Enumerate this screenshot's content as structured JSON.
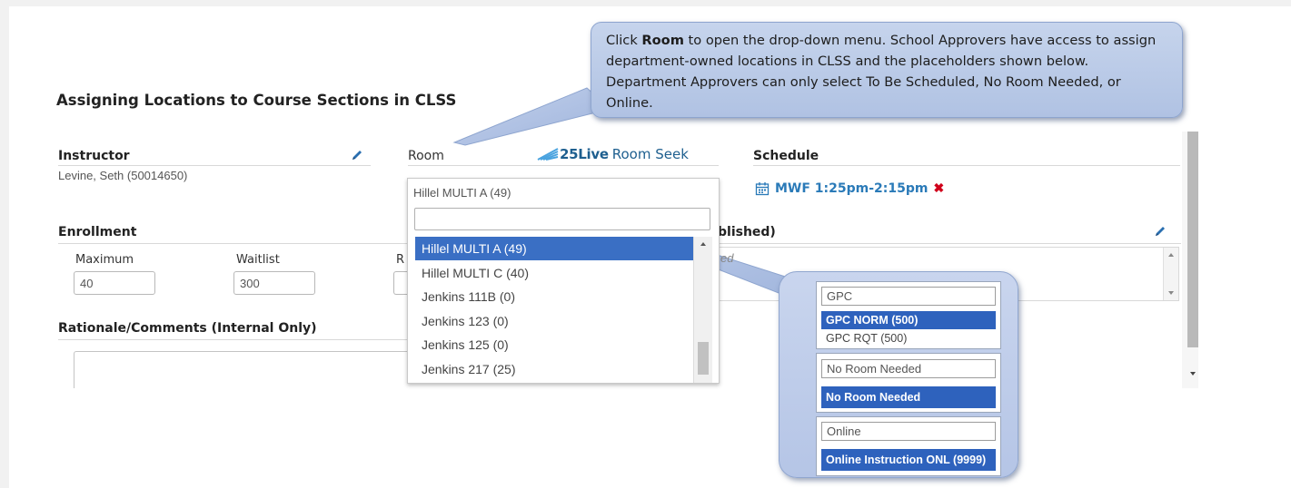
{
  "page": {
    "title": "Assigning Locations to Course Sections in CLSS"
  },
  "callout": {
    "part1": "Click ",
    "bold": "Room",
    "part2": " to open the drop-down menu. School Approvers have access to assign department-owned locations in CLSS and the placeholders shown below. Department Approvers can only select To Be Scheduled, No Room Needed, or Online."
  },
  "instructor": {
    "label": "Instructor",
    "value": "Levine, Seth (50014650)"
  },
  "room": {
    "label": "Room",
    "brand_name": "25Live",
    "brand_suffix": "Room Seek",
    "current": "Hillel MULTI A (49)",
    "search_value": "",
    "options": [
      "Hillel MULTI A (49)",
      "Hillel MULTI C (40)",
      "Jenkins 111B (0)",
      "Jenkins 123 (0)",
      "Jenkins 125 (0)",
      "Jenkins 217 (25)"
    ],
    "selected_index": 0
  },
  "schedule": {
    "label": "Schedule",
    "value": "MWF 1:25pm-2:15pm",
    "remove_symbol": "✖"
  },
  "enrollment": {
    "label": "Enrollment",
    "maximum_label": "Maximum",
    "maximum_value": "40",
    "waitlist_label": "Waitlist",
    "waitlist_value": "300",
    "third_label_partial": "R"
  },
  "notes": {
    "label_partial": "blished)",
    "placeholder_partial": "ed"
  },
  "rationale": {
    "label": "Rationale/Comments (Internal Only)"
  },
  "inset": {
    "gpc": {
      "search_value": "GPC",
      "options": [
        "GPC NORM (500)",
        "GPC RQT (500)"
      ]
    },
    "no_room": {
      "search_value": "No Room Needed",
      "options": [
        "No Room Needed"
      ]
    },
    "online": {
      "search_value": "Online",
      "options": [
        "Online Instruction ONL (9999)"
      ]
    }
  },
  "colors": {
    "selected_blue": "#3a6fc4",
    "link_blue": "#2a7ab8",
    "remove_red": "#d0021b",
    "callout_blue": "#b7c8e6"
  }
}
